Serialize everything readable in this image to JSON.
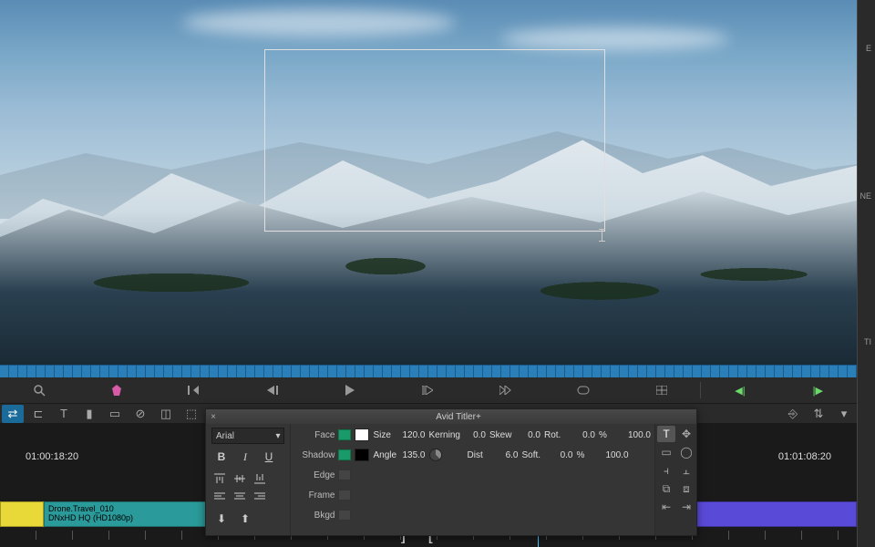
{
  "viewer": {
    "title_box_present": true
  },
  "right_panel": {
    "label_top": "E",
    "label_mid": "NE",
    "label_low": "TI"
  },
  "transport": {
    "buttons": [
      "zoom-in",
      "marker",
      "step-back",
      "play-reverse",
      "play",
      "play-forward",
      "step-forward",
      "loop",
      "grid",
      "mark-in",
      "mark-out"
    ]
  },
  "toolbar": {
    "active_tool": "segment-mode"
  },
  "timecode": {
    "in": "01:00:18:20",
    "out": "01:01:08:20"
  },
  "titler": {
    "title": "Avid Titler+",
    "font": {
      "family": "Arial",
      "bold_label": "B",
      "italic_label": "I",
      "underline_label": "U"
    },
    "face": {
      "label": "Face",
      "enabled": true,
      "color": "#ffffff",
      "size_label": "Size",
      "size": "120.0",
      "kerning_label": "Kerning",
      "kerning": "0.0",
      "skew_label": "Skew",
      "skew": "0.0",
      "rot_label": "Rot.",
      "rot": "0.0",
      "opacity_pct_label": "%",
      "opacity": "100.0"
    },
    "shadow": {
      "label": "Shadow",
      "enabled": true,
      "color": "#000000",
      "angle_label": "Angle",
      "angle": "135.0",
      "dist_label": "Dist",
      "dist": "6.0",
      "soft_label": "Soft.",
      "soft": "0.0",
      "opacity_pct_label": "%",
      "opacity": "100.0"
    },
    "edge": {
      "label": "Edge",
      "enabled": false
    },
    "frame": {
      "label": "Frame",
      "enabled": false
    },
    "bkgd": {
      "label": "Bkgd",
      "enabled": false
    },
    "right_tools": {
      "text_active": true
    }
  },
  "clip": {
    "name": "Drone.Travel_010",
    "codec": "DNxHD HQ (HD1080p)"
  }
}
